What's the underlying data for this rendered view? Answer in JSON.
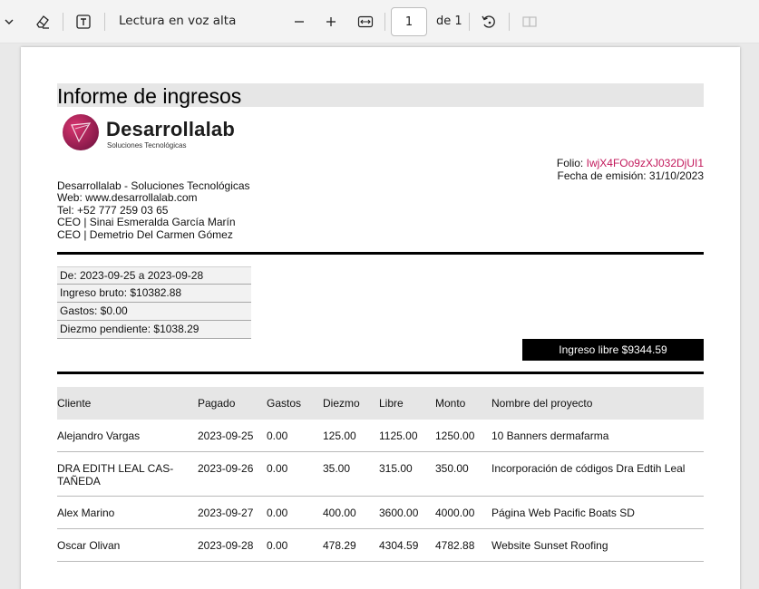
{
  "toolbar": {
    "read_aloud": "Lectura en voz alta",
    "page_number": "1",
    "page_total": "de 1",
    "icons": [
      "chevron-down-icon",
      "eraser-icon",
      "text-icon",
      "zoom-out-icon",
      "zoom-in-icon",
      "fit-width-icon",
      "rotate-icon",
      "two-page-icon"
    ]
  },
  "report": {
    "title": "Informe de ingresos",
    "logo": {
      "name": "Desarrollalab",
      "tagline": "Soluciones Tecnológicas"
    },
    "folio_label": "Folio: ",
    "folio_value": "IwjX4FOo9zXJ032DjUI1",
    "issue_date": "Fecha de emisión: 31/10/2023",
    "company": [
      "Desarrollalab - Soluciones Tecnológicas",
      "Web: www.desarrollalab.com",
      "Tel: +52 777 259 03 65",
      "CEO | Sinai Esmeralda García Marín",
      "CEO | Demetrio Del Carmen Gómez"
    ],
    "summary": [
      "De: 2023-09-25 a 2023-09-28",
      "Ingreso bruto: $10382.88",
      "Gastos: $0.00",
      "Diezmo pendiente: $1038.29"
    ],
    "net_income": "Ingreso libre $9344.59",
    "accent_color": "#c2185b",
    "table": {
      "headers": [
        "Cliente",
        "Pagado",
        "Gastos",
        "Diezmo",
        "Libre",
        "Monto",
        "Nombre del proyecto"
      ],
      "rows": [
        [
          "Alejandro Vargas",
          "2023-09-25",
          "0.00",
          "125.00",
          "1125.00",
          "1250.00",
          "10 Banners dermafarma"
        ],
        [
          "DRA EDITH LEAL CAS-\nTAÑEDA",
          "2023-09-26",
          "0.00",
          "35.00",
          "315.00",
          "350.00",
          "Incorporación de códigos Dra Edtih Leal"
        ],
        [
          "Alex Marino",
          "2023-09-27",
          "0.00",
          "400.00",
          "3600.00",
          "4000.00",
          "Página Web Pacific Boats SD"
        ],
        [
          "Oscar Olivan",
          "2023-09-28",
          "0.00",
          "478.29",
          "4304.59",
          "4782.88",
          "Website Sunset Roofing"
        ]
      ]
    }
  }
}
